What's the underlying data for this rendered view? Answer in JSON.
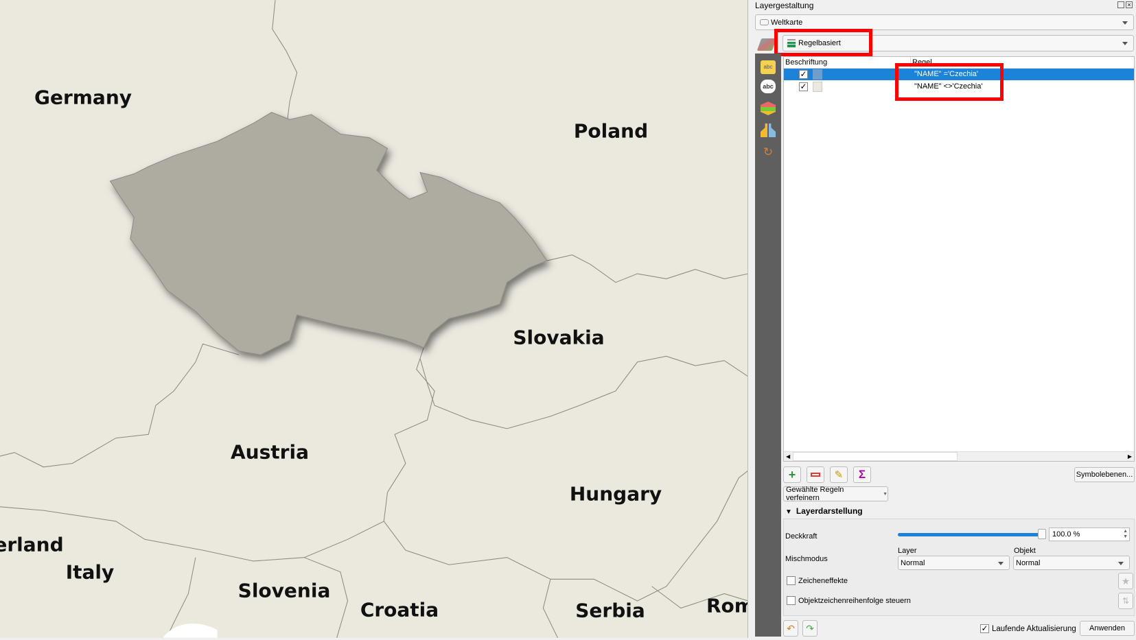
{
  "map": {
    "labels": [
      "Germany",
      "Poland",
      "Slovakia",
      "Austria",
      "Hungary",
      "erland",
      "Italy",
      "Slovenia",
      "Croatia",
      "Serbia",
      "Romania"
    ],
    "colors": {
      "background": "#ebe8de",
      "highlight": "#aeaba0",
      "border": "#8d8b85"
    }
  },
  "panel": {
    "title": "Layergestaltung",
    "layer_combo": {
      "value": "Weltkarte",
      "icon": "polygon-layer-icon"
    },
    "renderer_combo": {
      "value": "Regelbasiert",
      "icon": "rule-based-icon"
    },
    "sidebar_icons": [
      "symbology-brush-icon",
      "labels-icon",
      "labels-abc-icon",
      "3d-view-icon",
      "diagram-icon",
      "history-icon"
    ],
    "tree": {
      "headers": [
        "Beschriftung",
        "Regel"
      ],
      "rows": [
        {
          "checked": true,
          "color": "#6e9fcc",
          "rule": "\"NAME\" ='Czechia'",
          "selected": true
        },
        {
          "checked": true,
          "color": "#ebe8de",
          "rule": "\"NAME\" <>'Czechia'",
          "selected": false
        }
      ]
    },
    "toolbar": {
      "symbol_levels": "Symbolebenen...",
      "refine": "Gewählte Regeln verfeinern"
    },
    "rendering": {
      "title": "Layerdarstellung",
      "opacity_label": "Deckkraft",
      "opacity_value": "100.0 %",
      "opacity_percent": 100,
      "blend_label": "Mischmodus",
      "layer_label": "Layer",
      "object_label": "Objekt",
      "layer_blend": "Normal",
      "object_blend": "Normal",
      "effects_label": "Zeicheneffekte",
      "effects_checked": false,
      "order_label": "Objektzeichenreihenfolge steuern",
      "order_checked": false
    },
    "footer": {
      "live_update": "Laufende Aktualisierung",
      "live_checked": true,
      "apply": "Anwenden"
    },
    "accent": "#1c83d8",
    "highlight_box": "#ff0000"
  }
}
